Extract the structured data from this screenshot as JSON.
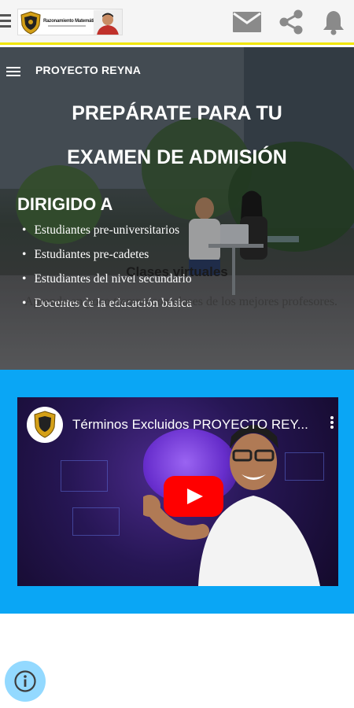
{
  "topbar": {
    "logo_tagline": "Razonamiento Matemático",
    "icons": [
      "menu-icon",
      "mail-icon",
      "share-icon",
      "bell-icon"
    ]
  },
  "hero": {
    "brand": "PROYECTO REYNA",
    "headline_line1": "PREPÁRATE PARA TU",
    "headline_line2": "EXAMEN DE ADMISIÓN",
    "audience_title": "DIRIGIDO A",
    "audience": [
      "Estudiantes pre-universitarios",
      "Estudiantes pre-cadetes",
      "Estudiantes del nivel secundario",
      "Docentes de la educación básica"
    ]
  },
  "video": {
    "title": "Términos Excluidos PROYECTO REY..."
  },
  "section": {
    "title": "Clases virtuales",
    "description": "Aprende en poco tiempo con clases de los mejores profesores."
  },
  "colors": {
    "accent_bar": "#f2e600",
    "section_bg": "#0aa6f5",
    "play_button": "#ff0000"
  }
}
